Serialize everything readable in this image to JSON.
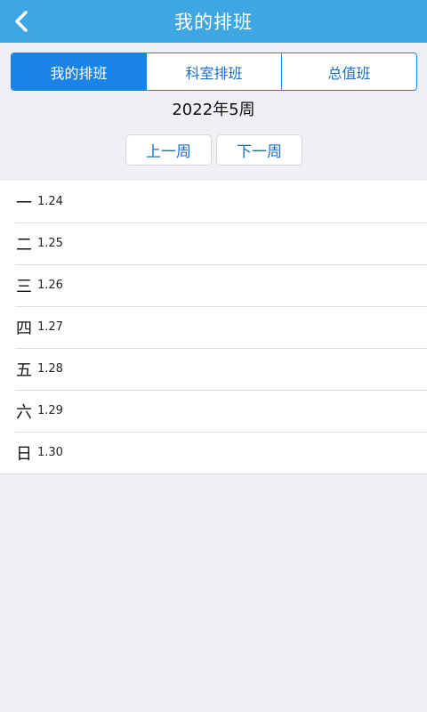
{
  "header": {
    "title": "我的排班",
    "back_icon": "chevron-left-icon"
  },
  "tabs": [
    {
      "label": "我的排班",
      "active": true
    },
    {
      "label": "科室排班",
      "active": false
    },
    {
      "label": "总值班",
      "active": false
    }
  ],
  "week": {
    "label": "2022年5周",
    "prev_label": "上一周",
    "next_label": "下一周"
  },
  "days": [
    {
      "weekday": "一",
      "date": "1.24"
    },
    {
      "weekday": "二",
      "date": "1.25"
    },
    {
      "weekday": "三",
      "date": "1.26"
    },
    {
      "weekday": "四",
      "date": "1.27"
    },
    {
      "weekday": "五",
      "date": "1.28"
    },
    {
      "weekday": "六",
      "date": "1.29"
    },
    {
      "weekday": "日",
      "date": "1.30"
    }
  ],
  "colors": {
    "header_bg": "#3ea6e3",
    "accent": "#1a84e6",
    "page_bg": "#efeff4"
  }
}
